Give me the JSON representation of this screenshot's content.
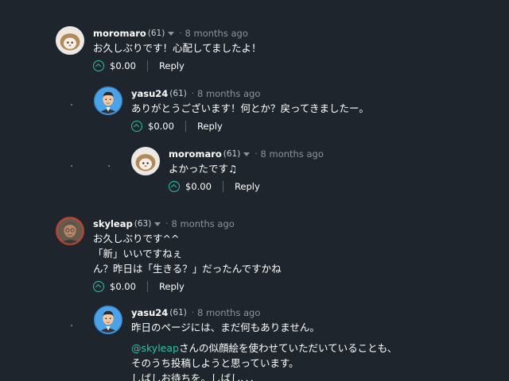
{
  "comments": [
    {
      "author": "moromaro",
      "rep": "(61)",
      "sep": "·",
      "time": "8 months ago",
      "lines": [
        "お久しぶりです！心配してましたよ！"
      ],
      "payout": "$0.00",
      "reply": "Reply"
    },
    {
      "author": "yasu24",
      "rep": "(61)",
      "sep": "·",
      "time": "8 months ago",
      "lines": [
        "ありがとうございます！何とか？戻ってきましたー。"
      ],
      "payout": "$0.00",
      "reply": "Reply"
    },
    {
      "author": "moromaro",
      "rep": "(61)",
      "sep": "·",
      "time": "8 months ago",
      "lines": [
        "よかったです♫"
      ],
      "payout": "$0.00",
      "reply": "Reply"
    },
    {
      "author": "skyleap",
      "rep": "(63)",
      "sep": "·",
      "time": "8 months ago",
      "lines": [
        "お久しぶりです^^",
        "「新」いいですねぇ",
        "ん？昨日は「生きる？」だったんですかね"
      ],
      "payout": "$0.00",
      "reply": "Reply"
    },
    {
      "author": "yasu24",
      "rep": "(61)",
      "sep": "·",
      "time": "8 months ago",
      "lines": [
        "昨日のページには、まだ何もありません。"
      ],
      "mention": "@skyleap",
      "lines2": [
        "さんの似顔絵を使わせていただいていることも、",
        "そのうち投稿しようと思っています。",
        "しばしお待ちを。しばし、、、"
      ]
    }
  ],
  "colors": {
    "background": "#1f252c",
    "accent": "#26c3a3",
    "muted": "#8a949c"
  }
}
